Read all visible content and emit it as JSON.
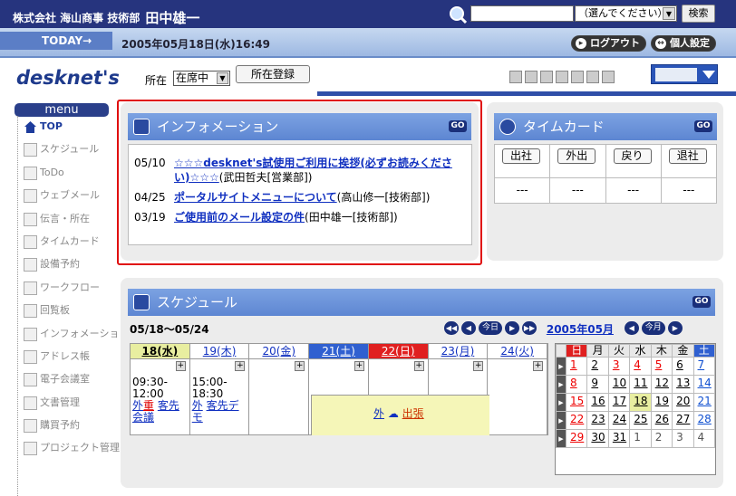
{
  "header": {
    "company": "株式会社 海山商事 技術部",
    "user": "田中雄一",
    "search_placeholder": "",
    "search_scope": "（選んでください）",
    "search_button": "検索"
  },
  "bar": {
    "today_label": "TODAY→",
    "datetime": "2005年05月18日(水)16:49",
    "logout": "ログアウト",
    "personal": "個人設定"
  },
  "logo": "desknet's",
  "location": {
    "label": "所在",
    "value": "在席中",
    "register": "所在登録"
  },
  "menu": {
    "header": "menu",
    "items": [
      "TOP",
      "スケジュール",
      "ToDo",
      "ウェブメール",
      "伝言・所在",
      "タイムカード",
      "設備予約",
      "ワークフロー",
      "回覧板",
      "インフォメーション",
      "アドレス帳",
      "電子会議室",
      "文書管理",
      "購買予約",
      "プロジェクト管理"
    ]
  },
  "info": {
    "title": "インフォメーション",
    "go": "GO",
    "items": [
      {
        "date": "05/10",
        "title": "☆☆☆desknet's試使用ご利用に挨拶(必ずお読みください)☆☆☆",
        "by": "(武田哲夫[営業部])"
      },
      {
        "date": "04/25",
        "title": "ポータルサイトメニューについて",
        "by": "(高山修一[技術部])"
      },
      {
        "date": "03/19",
        "title": "ご使用前のメール設定の件",
        "by": "(田中雄一[技術部])"
      }
    ]
  },
  "timecard": {
    "title": "タイムカード",
    "go": "GO",
    "buttons": [
      "出社",
      "外出",
      "戻り",
      "退社"
    ],
    "values": [
      "---",
      "---",
      "---",
      "---"
    ]
  },
  "schedule": {
    "title": "スケジュール",
    "go": "GO",
    "range": "05/18～05/24",
    "today_btn": "今日",
    "month": "2005年05月",
    "month_today_btn": "今月",
    "days": [
      "18(水)",
      "19(木)",
      "20(金)",
      "21(土)",
      "22(日)",
      "23(月)",
      "24(火)"
    ],
    "ev1": {
      "time": "09:30-\n12:00",
      "tag1": "外",
      "tag2": "重",
      "text": "客先会議"
    },
    "ev2": {
      "time": "15:00-\n18:30",
      "tag1": "外",
      "text": "客先デモ"
    },
    "trip": {
      "tag": "外",
      "text": "出張"
    }
  },
  "calendar": {
    "headers": [
      "日",
      "月",
      "火",
      "水",
      "木",
      "金",
      "土"
    ],
    "weeks": [
      [
        "1",
        "2",
        "3",
        "4",
        "5",
        "6",
        "7"
      ],
      [
        "8",
        "9",
        "10",
        "11",
        "12",
        "13",
        "14"
      ],
      [
        "15",
        "16",
        "17",
        "18",
        "19",
        "20",
        "21"
      ],
      [
        "22",
        "23",
        "24",
        "25",
        "26",
        "27",
        "28"
      ],
      [
        "29",
        "30",
        "31",
        "1",
        "2",
        "3",
        "4"
      ]
    ]
  }
}
